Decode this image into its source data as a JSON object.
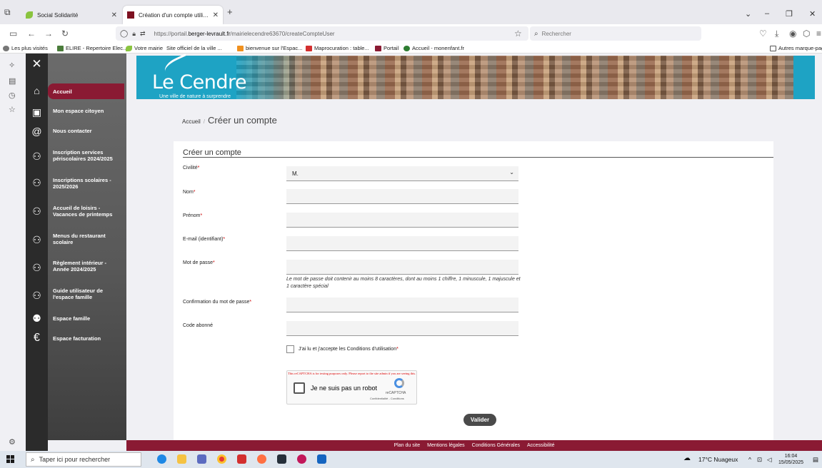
{
  "browser": {
    "tabs": [
      {
        "label": "Social Solidarité",
        "favicon_color": "#8ac43f"
      },
      {
        "label": "Création d'un compte utilisateur",
        "favicon_color": "#7d1020"
      }
    ],
    "new_tab_label": "+",
    "url_prefix": "https://portail.",
    "url_host": "berger-levrault.fr",
    "url_path": "/mairielecendre63670/createCompteUser",
    "search_placeholder": "Rechercher",
    "bookmarks": [
      {
        "label": "Les plus visités",
        "color": "#777777"
      },
      {
        "label": "ELIRE - Repertoire Elec...",
        "color": "#4a7c3a"
      },
      {
        "label": "Votre mairie",
        "color": "#8ac43f"
      },
      {
        "label": "Site officiel de la ville ...",
        "color": "#ffffff"
      },
      {
        "label": "bienvenue sur l'Espac...",
        "color": "#f0901e"
      },
      {
        "label": "Maprocuration : table...",
        "color": "#d32f2f"
      },
      {
        "label": "Portail",
        "color": "#8a1a33"
      },
      {
        "label": "Accueil - monenfant.fr",
        "color": "#2e7d32"
      }
    ],
    "other_bookmarks": "Autres marque-pag"
  },
  "site": {
    "logo_text": "Le Cendre",
    "tagline": "Une ville de nature à surprendre",
    "menu": [
      {
        "label": "Accueil",
        "icon": "home-icon",
        "glyph": "⌂",
        "active": true
      },
      {
        "label": "Mon espace citoyen",
        "icon": "id-card-icon",
        "glyph": "▣",
        "active": false
      },
      {
        "label": "Nous contacter",
        "icon": "at-icon",
        "glyph": "@",
        "active": false
      },
      {
        "label": "Inscription services périscolaires 2024/2025",
        "icon": "people-icon",
        "glyph": "⚇",
        "active": false
      },
      {
        "label": "Inscriptions scolaires - 2025/2026",
        "icon": "people-icon",
        "glyph": "⚇",
        "active": false
      },
      {
        "label": "Accueil de loisirs - Vacances de printemps",
        "icon": "people-icon",
        "glyph": "⚇",
        "active": false
      },
      {
        "label": "Menus du restaurant scolaire",
        "icon": "people-icon",
        "glyph": "⚇",
        "active": false
      },
      {
        "label": "Règlement intérieur - Année 2024/2025",
        "icon": "people-icon",
        "glyph": "⚇",
        "active": false
      },
      {
        "label": "Guide utilisateur de l'espace famille",
        "icon": "people-icon",
        "glyph": "⚇",
        "active": false
      },
      {
        "label": "Espace famille",
        "icon": "family-icon",
        "glyph": "⚉",
        "active": false
      },
      {
        "label": "Espace facturation",
        "icon": "euro-icon",
        "glyph": "€",
        "active": false
      }
    ],
    "close_glyph": "✕",
    "breadcrumb_home": "Accueil",
    "breadcrumb_sep": "/",
    "breadcrumb_current": "Créer un compte",
    "footer_links": [
      "Plan du site",
      "Mentions légales",
      "Conditions Générales",
      "Accessibilité"
    ]
  },
  "form": {
    "title": "Créer un compte",
    "civilite_label": "Civilité",
    "civilite_value": "M.",
    "nom_label": "Nom",
    "prenom_label": "Prénom",
    "email_label": "E-mail (identifiant)",
    "password_label": "Mot de passe",
    "password_hint": "Le mot de passe doit contenir au moins 8 caractères, dont au moins 1 chiffre, 1 minuscule, 1 majuscule et 1 caractère spécial",
    "password_confirm_label": "Confirmation du mot de passe",
    "code_label": "Code abonné",
    "required_mark": "*",
    "cgu_label": "J'ai lu et j'accepte les Conditions d'utilisation",
    "recaptcha_warning": "This reCAPTCHA is for testing purposes only. Please report to the site admin if you are seeing this.",
    "recaptcha_label": "Je ne suis pas un robot",
    "recaptcha_brand": "reCAPTCHA",
    "recaptcha_terms": "Confidentialité - Conditions",
    "submit_label": "Valider"
  },
  "taskbar": {
    "search_placeholder": "Taper ici pour rechercher",
    "weather": "17°C Nuageux",
    "time": "16:04",
    "date": "15/05/2025"
  }
}
